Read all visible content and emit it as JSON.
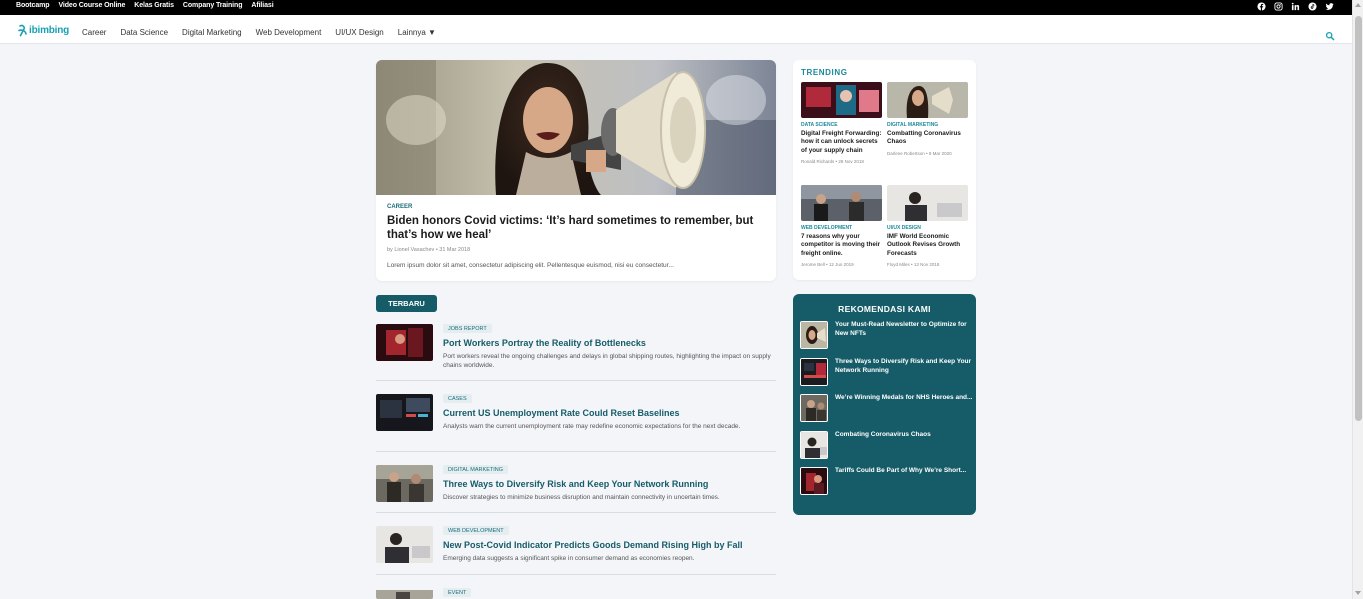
{
  "topbar": {
    "links": [
      "Bootcamp",
      "Video Course Online",
      "Kelas Gratis",
      "Company Training",
      "Afiliasi"
    ],
    "social": [
      "facebook-icon",
      "instagram-icon",
      "linkedin-icon",
      "tiktok-icon",
      "twitter-icon"
    ]
  },
  "nav": {
    "logo": "ibimbing",
    "links": [
      "Career",
      "Data Science",
      "Digital Marketing",
      "Web Development",
      "UI/UX Design",
      "Lainnya ▼"
    ],
    "search_icon": "search-icon"
  },
  "colors": {
    "brand": "#1a9fb3",
    "dark_teal": "#165c68",
    "background": "#f3f5f8"
  },
  "hero": {
    "category": "CAREER",
    "title": "Biden honors Covid victims: ‘It’s hard sometimes to remember, but that’s how we heal’",
    "meta": "by Lionel Vasachev • 31 Mar 2018",
    "excerpt": "Lorem ipsum dolor sit amet, consectetur adipiscing elit. Pellentesque euismod, nisi eu consectetur..."
  },
  "trending": {
    "title": "TRENDING",
    "items": [
      {
        "category": "DATA SCIENCE",
        "title": "Digital Freight Forwarding: how it can unlock secrets of your supply chain",
        "meta": "Ronald Richards • 28 Nov 2018"
      },
      {
        "category": "DIGITAL MARKETING",
        "title": "Combatting Coronavirus Chaos",
        "meta": "Darlene Robertson • 9 Mar 2020"
      },
      {
        "category": "WEB DEVELOPMENT",
        "title": "7 reasons why your competitor is moving their freight online.",
        "meta": "Jerome Bell • 12 Jun 2019"
      },
      {
        "category": "UI/UX DESIGN",
        "title": "IMF World Economic Outlook Revises Growth Forecasts",
        "meta": "Floyd Miles • 13 Nov 2018"
      }
    ]
  },
  "latest": {
    "badge": "TERBARU",
    "items": [
      {
        "tag": "JOBS REPORT",
        "title": "Port Workers Portray the Reality of Bottlenecks",
        "desc": "Port workers reveal the ongoing challenges and delays in global shipping routes, highlighting the impact on supply chains worldwide."
      },
      {
        "tag": "CASES",
        "title": "Current US Unemployment Rate Could Reset Baselines",
        "desc": "Analysts warn the current unemployment rate may redefine economic expectations for the next decade."
      },
      {
        "tag": "DIGITAL MARKETING",
        "title": "Three Ways to Diversify Risk and Keep Your Network Running",
        "desc": "Discover strategies to minimize business disruption and maintain connectivity in uncertain times."
      },
      {
        "tag": "WEB DEVELOPMENT",
        "title": "New Post-Covid Indicator Predicts Goods Demand Rising High by Fall",
        "desc": "Emerging data suggests a significant spike in consumer demand as economies reopen."
      },
      {
        "tag": "EVENT",
        "title": "",
        "desc": ""
      }
    ]
  },
  "rekomendasi": {
    "title": "REKOMENDASI KAMI",
    "items": [
      "Your Must-Read Newsletter to Optimize for New NFTs",
      "Three Ways to Diversify Risk and Keep Your Network Running",
      "We’re Winning Medals for NHS Heroes and...",
      "Combating Coronavirus Chaos",
      "Tariffs Could Be Part of Why We’re Short..."
    ]
  }
}
